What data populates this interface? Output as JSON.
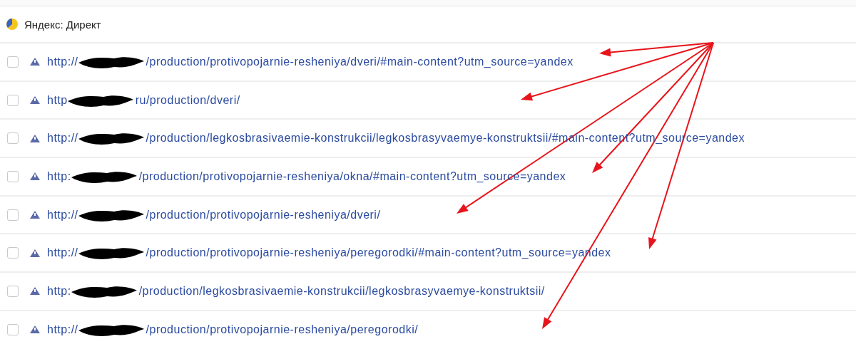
{
  "header": {
    "title": "Яндекс: Директ"
  },
  "rows": [
    {
      "checked": false,
      "prefix": "http://",
      "suffix": "/production/protivopojarnie-resheniya/dveri/#main-content?utm_source=yandex"
    },
    {
      "checked": false,
      "prefix": "http",
      "suffix": "ru/production/dveri/"
    },
    {
      "checked": false,
      "prefix": "http://",
      "suffix": "/production/legkosbrasivaemie-konstrukcii/legkosbrasyvaemye-konstruktsii/#main-content?utm_source=yandex"
    },
    {
      "checked": false,
      "prefix": "http:",
      "suffix": "/production/protivopojarnie-resheniya/okna/#main-content?utm_source=yandex"
    },
    {
      "checked": false,
      "prefix": "http://",
      "suffix": "/production/protivopojarnie-resheniya/dveri/"
    },
    {
      "checked": false,
      "prefix": "http://",
      "suffix": "/production/protivopojarnie-resheniya/peregorodki/#main-content?utm_source=yandex"
    },
    {
      "checked": false,
      "prefix": "http:",
      "suffix": "/production/legkosbrasivaemie-konstrukcii/legkosbrasyvaemye-konstruktsii/"
    },
    {
      "checked": false,
      "prefix": "http://",
      "suffix": "/production/protivopojarnie-resheniya/peregorodki/"
    }
  ]
}
